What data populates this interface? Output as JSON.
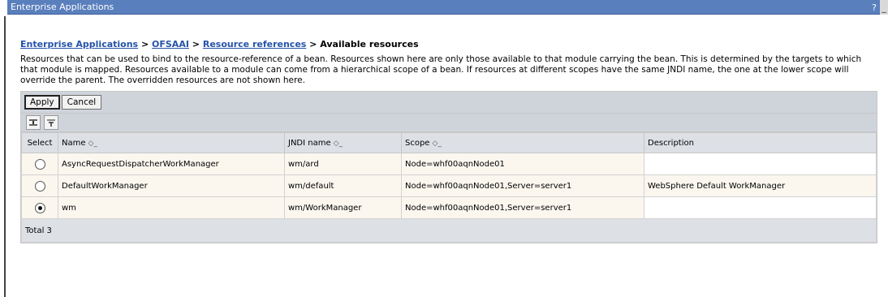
{
  "window": {
    "title": "Enterprise Applications",
    "help_label": "?",
    "minimize_label": "_"
  },
  "breadcrumb": {
    "items": [
      "Enterprise Applications",
      "OFSAAI",
      "Resource references"
    ],
    "separator": ">",
    "current": "Available resources"
  },
  "description": "Resources that can be used to bind to the resource-reference of a bean. Resources shown here are only those available to that module carrying the bean. This is determined by the targets to which that module is mapped. Resources available to a module can come from a hierarchical scope of a bean. If resources at different scopes have the same JNDI name, the one at the lower scope will override the parent. The overridden resources are not shown here.",
  "buttons": {
    "apply": "Apply",
    "cancel": "Cancel"
  },
  "icons": [
    "select-all-icon",
    "deselect-all-icon"
  ],
  "table": {
    "columns": {
      "select": "Select",
      "name": "Name",
      "jndi": "JNDI name",
      "scope": "Scope",
      "description": "Description"
    },
    "rows": [
      {
        "selected": false,
        "name": "AsyncRequestDispatcherWorkManager",
        "jndi": "wm/ard",
        "scope": "Node=whf00aqnNode01",
        "description": ""
      },
      {
        "selected": false,
        "name": "DefaultWorkManager",
        "jndi": "wm/default",
        "scope": "Node=whf00aqnNode01,Server=server1",
        "description": "WebSphere Default WorkManager"
      },
      {
        "selected": true,
        "name": "wm",
        "jndi": "wm/WorkManager",
        "scope": "Node=whf00aqnNode01,Server=server1",
        "description": ""
      }
    ],
    "total_label": "Total 3"
  },
  "colors": {
    "titlebar": "#5a7fbd",
    "link": "#2453a8",
    "header_bg": "#dde1e6",
    "row_bg": "#fbf7ef"
  }
}
